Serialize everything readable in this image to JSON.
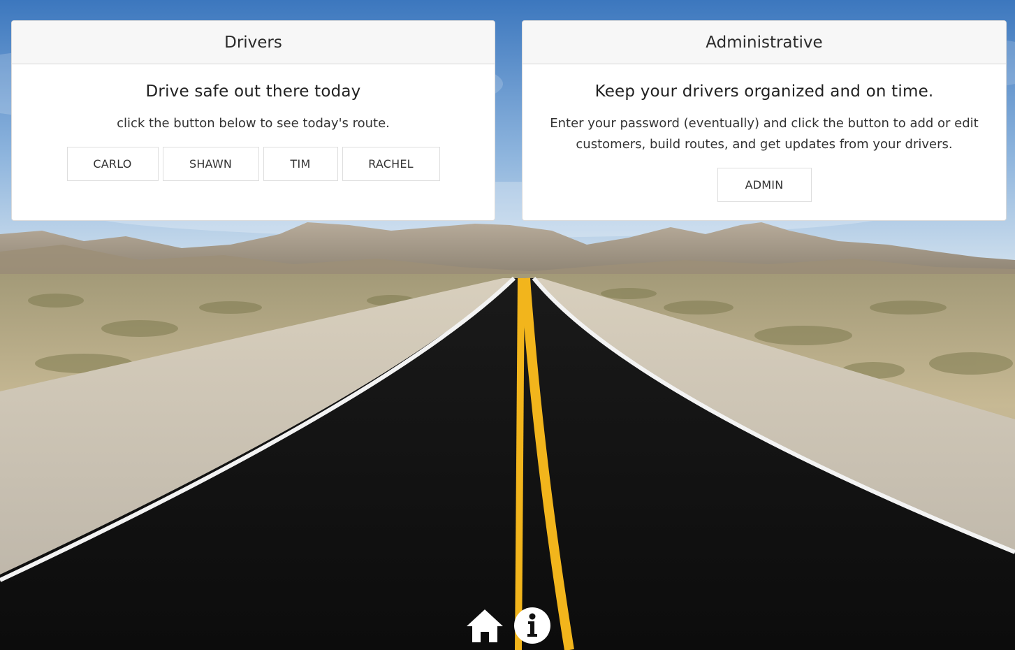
{
  "drivers_card": {
    "header": "Drivers",
    "title": "Drive safe out there today",
    "text": "click the button below to see today's route.",
    "buttons": [
      "CARLO",
      "SHAWN",
      "TIM",
      "RACHEL"
    ]
  },
  "admin_card": {
    "header": "Administrative",
    "title": "Keep your drivers organized and on time.",
    "text": "Enter your password (eventually) and click the button to add or edit customers, build routes, and get updates from your drivers.",
    "button": "ADMIN"
  },
  "bottom_nav": {
    "icons": [
      "home-icon",
      "info-icon"
    ]
  },
  "colors": {
    "sky_top": "#3f7bc2",
    "sky_bottom": "#c9ddef",
    "road": "#141414",
    "center_line": "#f2b51c",
    "desert": "#c8b796"
  }
}
